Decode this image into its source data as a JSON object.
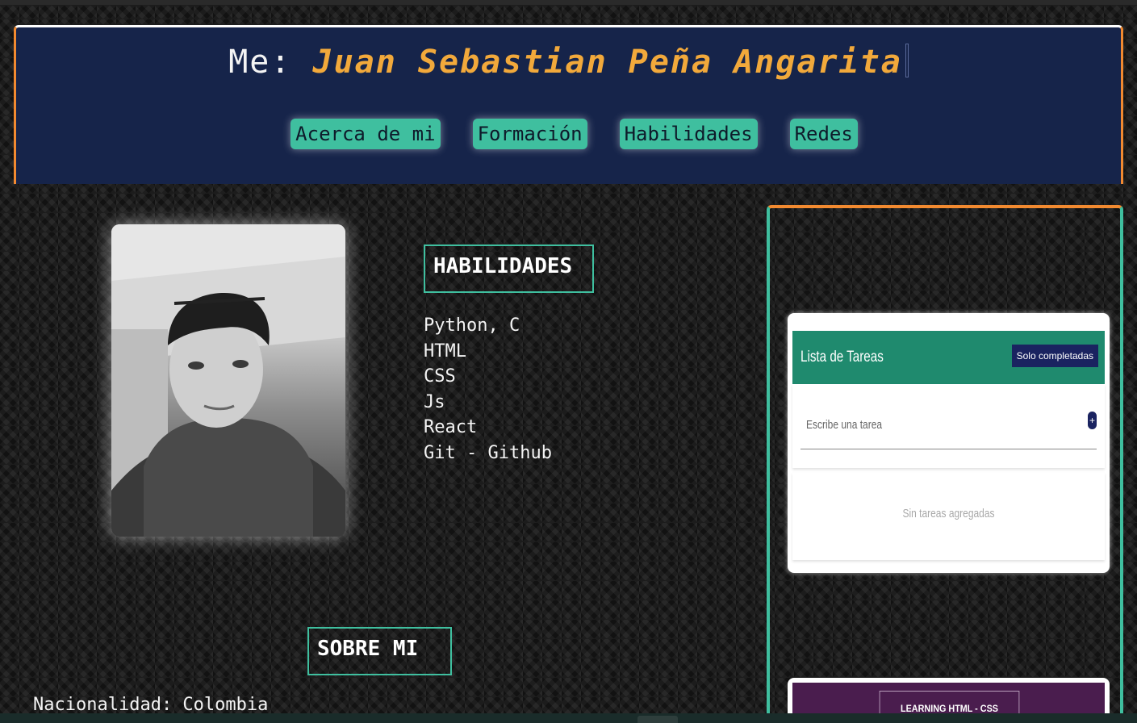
{
  "header": {
    "title_prefix": "Me: ",
    "title_name": "Juan Sebastian Peña Angarita",
    "nav": [
      {
        "label": "Acerca de mi"
      },
      {
        "label": "Formación"
      },
      {
        "label": "Habilidades"
      },
      {
        "label": "Redes"
      }
    ]
  },
  "skills": {
    "heading": "HABILIDADES",
    "items": [
      "Python, C",
      "HTML",
      "CSS",
      "Js",
      "React",
      "Git - Github"
    ]
  },
  "about": {
    "heading": "SOBRE MI",
    "nationality": "Nacionalidad: Colombia"
  },
  "projects": {
    "todo_card": {
      "title": "Lista de Tareas",
      "filter_button": "Solo completadas",
      "input_placeholder": "Escribe una tarea",
      "add_button": "+",
      "empty_message": "Sin tareas agregadas"
    },
    "learning_card": {
      "label": "LEARNING HTML - CSS"
    }
  },
  "colors": {
    "accent_orange": "#f28a30",
    "accent_teal": "#3fbf9f",
    "header_bg": "#16244a",
    "name_gold": "#f2a93b"
  }
}
